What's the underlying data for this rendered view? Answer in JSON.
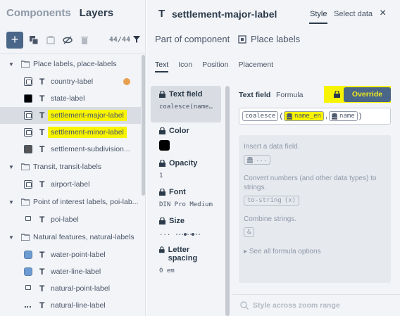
{
  "left": {
    "tabs": {
      "components": "Components",
      "layers": "Layers"
    },
    "toolbar": {
      "count": "44/44"
    },
    "tree": [
      {
        "group": "Place labels, place-labels"
      },
      {
        "layer": "country-label"
      },
      {
        "layer": "state-label"
      },
      {
        "layer": "settlement-major-label"
      },
      {
        "layer": "settlement-minor-label"
      },
      {
        "layer": "settlement-subdivision..."
      },
      {
        "group": "Transit, transit-labels"
      },
      {
        "layer": "airport-label"
      },
      {
        "group": "Point of interest labels, poi-lab..."
      },
      {
        "layer": "poi-label"
      },
      {
        "group": "Natural features, natural-labels"
      },
      {
        "layer": "water-point-label"
      },
      {
        "layer": "water-line-label"
      },
      {
        "layer": "natural-point-label"
      },
      {
        "layer": "natural-line-label"
      }
    ]
  },
  "right": {
    "header": {
      "type_glyph": "T",
      "title": "settlement-major-label",
      "style_tab": "Style",
      "select_data_tab": "Select data",
      "close": "×"
    },
    "component": {
      "prefix": "Part of component",
      "name": "Place labels"
    },
    "subtabs": [
      "Text",
      "Icon",
      "Position",
      "Placement"
    ],
    "properties": {
      "text_field": {
        "label": "Text field",
        "value": "coalesce(name..."
      },
      "color": {
        "label": "Color",
        "value": "#000000"
      },
      "opacity": {
        "label": "Opacity",
        "value": "1"
      },
      "font": {
        "label": "Font",
        "value": "DIN Pro Medium"
      },
      "size": {
        "label": "Size",
        "value": "..."
      },
      "letter_spacing": {
        "label": "Letter spacing",
        "value": "0 em"
      }
    },
    "editor": {
      "title": "Text field",
      "mode": "Formula",
      "override": "Override",
      "expression": {
        "fn": "coalesce",
        "arg1": "name_en",
        "arg2": "name"
      },
      "help": {
        "insert_text": "Insert a data field.",
        "insert_chip": "...",
        "convert_text": "Convert numbers (and other data types) to strings.",
        "convert_chip": "to-string",
        "convert_chip_arg": "(x)",
        "combine_text": "Combine strings.",
        "combine_chip": "&",
        "see_all": "See all formula options"
      },
      "zoom": "Style across zoom range"
    }
  }
}
